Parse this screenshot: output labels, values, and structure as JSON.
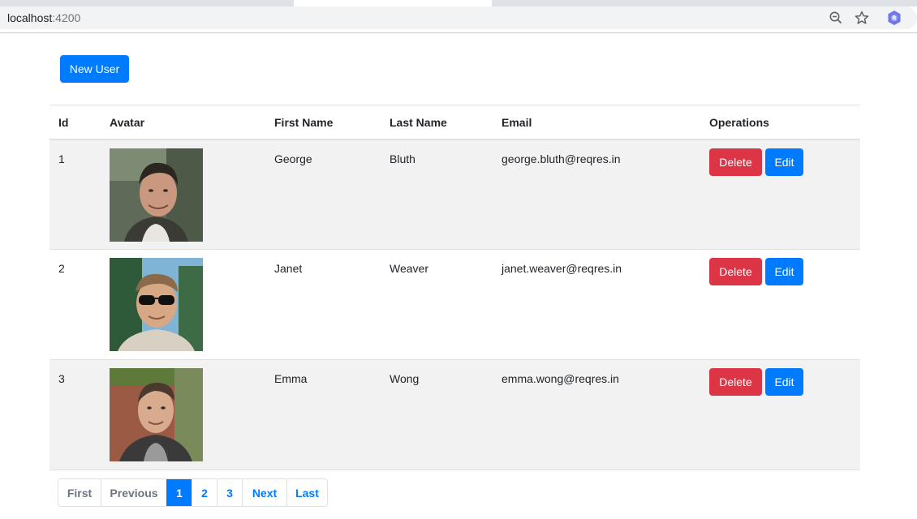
{
  "browser": {
    "url_host": "localhost",
    "url_port": ":4200",
    "icons": [
      "info-icon",
      "zoom-icon",
      "star-icon",
      "extension-icon"
    ]
  },
  "page": {
    "new_user_label": "New User",
    "table": {
      "headers": [
        "Id",
        "Avatar",
        "First Name",
        "Last Name",
        "Email",
        "Operations"
      ],
      "rows": [
        {
          "id": "1",
          "first_name": "George",
          "last_name": "Bluth",
          "email": "george.bluth@reqres.in"
        },
        {
          "id": "2",
          "first_name": "Janet",
          "last_name": "Weaver",
          "email": "janet.weaver@reqres.in"
        },
        {
          "id": "3",
          "first_name": "Emma",
          "last_name": "Wong",
          "email": "emma.wong@reqres.in"
        }
      ],
      "delete_label": "Delete",
      "edit_label": "Edit"
    },
    "pagination": {
      "first": "First",
      "previous": "Previous",
      "pages": [
        "1",
        "2",
        "3"
      ],
      "current_page": "1",
      "next": "Next",
      "last": "Last"
    }
  },
  "colors": {
    "primary": "#007bff",
    "danger": "#dc3545",
    "striped_row": "#f2f2f2"
  }
}
